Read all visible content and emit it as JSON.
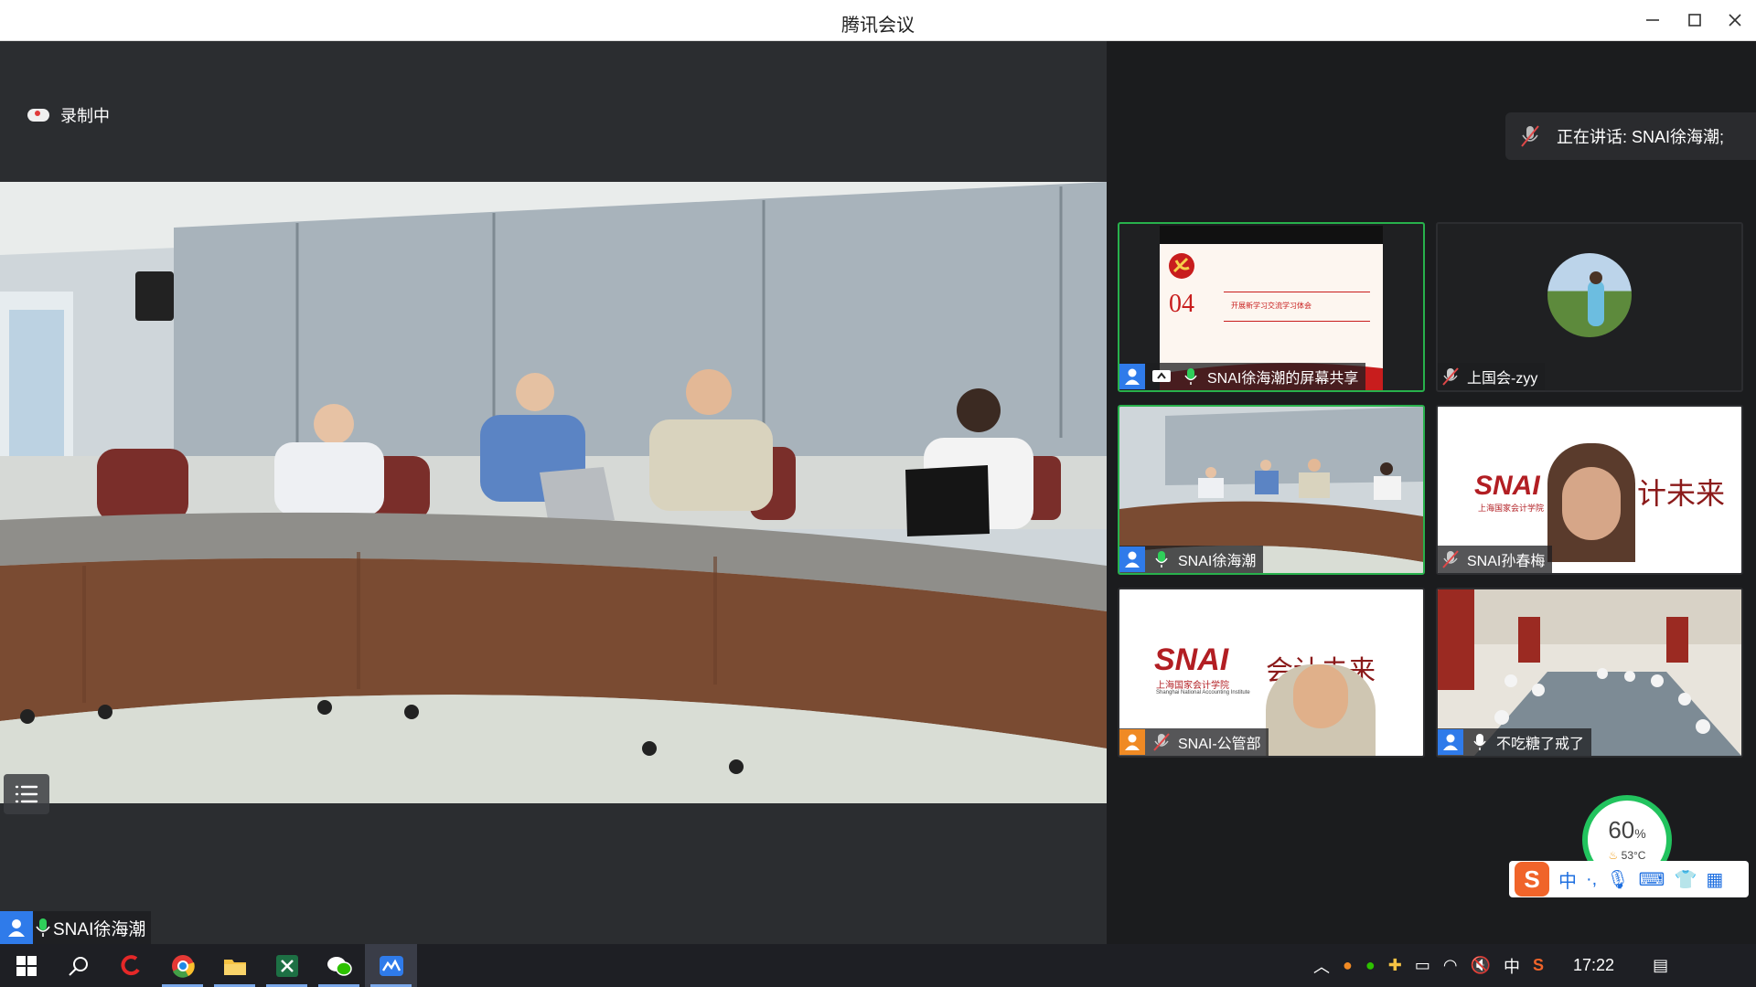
{
  "window": {
    "title": "腾讯会议"
  },
  "recording": {
    "label": "录制中"
  },
  "speaking": {
    "label": "正在讲话: SNAI徐海潮;"
  },
  "main": {
    "speaker_name": "SNAI徐海潮"
  },
  "tiles": [
    {
      "name": "SNAI徐海潮的屏幕共享",
      "slide_number": "04",
      "slide_text": "开展新学习交流学习体会",
      "active": true
    },
    {
      "name": "上国会-zyy",
      "active": false
    },
    {
      "name": "SNAI徐海潮",
      "active": true
    },
    {
      "name": "SNAI孙春梅",
      "banner_logo": "SNAI",
      "banner_sub": "上海国家会计学院",
      "banner_right": "计未来",
      "active": false
    },
    {
      "name": "SNAI-公管部",
      "banner_logo": "SNAI",
      "banner_sub": "上海国家会计学院",
      "banner_sub2": "Shanghai National Accounting Institute",
      "banner_right": "会计未来",
      "active": false
    },
    {
      "name": "不吃糖了戒了",
      "active": false
    }
  ],
  "gauge": {
    "percent": "60",
    "unit": "%",
    "temp": "53°C"
  },
  "ime": {
    "mode": "中",
    "punct": "·,"
  },
  "taskbar": {
    "clock": "17:22",
    "ime_lang": "中"
  },
  "colors": {
    "accent_green": "#28b14c",
    "user_blue": "#2f7bea",
    "titlebar": "#ffffff",
    "stage_bg": "#2b2d30"
  }
}
